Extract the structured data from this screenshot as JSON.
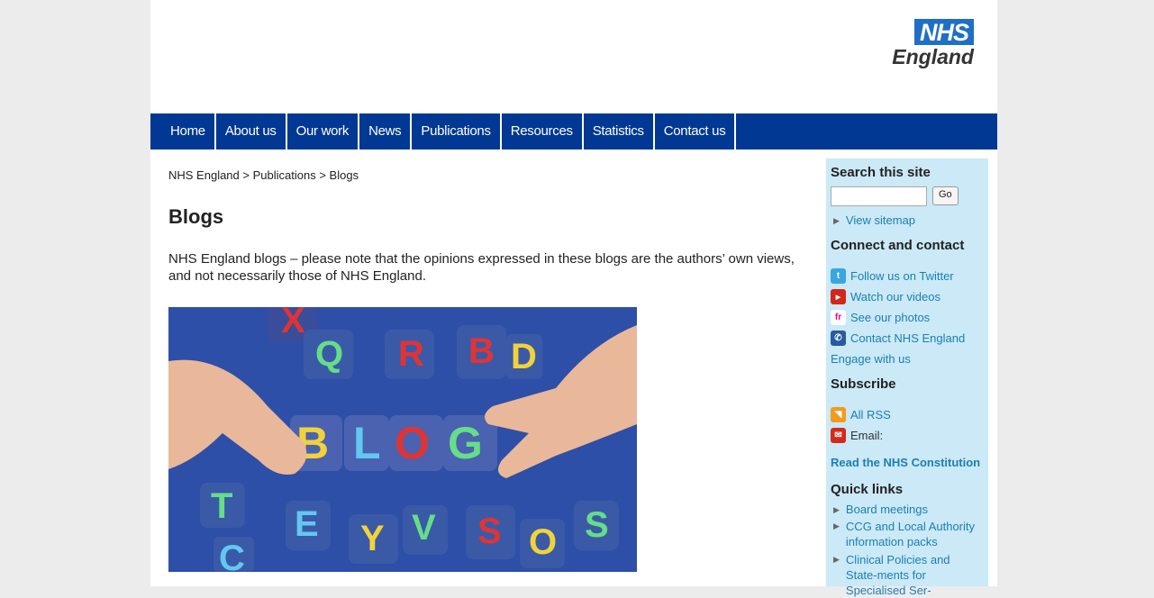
{
  "logo": {
    "nhs": "NHS",
    "england": "England"
  },
  "nav": [
    "Home",
    "About us",
    "Our work",
    "News",
    "Publications",
    "Resources",
    "Statistics",
    "Contact us"
  ],
  "breadcrumb": {
    "home": "NHS England",
    "sep": " > ",
    "section": "Publications",
    "current": "Blogs"
  },
  "page_title": "Blogs",
  "intro": "NHS England blogs – please note that the opinions expressed in these blogs are the authors’ own views, and not necessarily those of NHS England.",
  "sidebar": {
    "search_heading": "Search this site",
    "go_label": "Go",
    "sitemap": "View sitemap",
    "connect_heading": "Connect and contact",
    "twitter": "Follow us on Twitter",
    "videos": "Watch our videos",
    "photos": "See our photos",
    "contact": "Contact NHS England",
    "engage": "Engage with us",
    "subscribe_heading": "Subscribe",
    "rss": "All RSS",
    "email": "Email:",
    "constitution": "Read the NHS Constitution",
    "quicklinks_heading": "Quick links",
    "quicklinks": [
      "Board meetings",
      "CCG and Local Authority information packs",
      "Clinical Policies and State-ments for Specialised Ser-"
    ]
  },
  "hero_letters": "BLOG",
  "colors": {
    "nav": "#003893",
    "sidebar": "#cbe9f6",
    "link": "#1b7fb5",
    "nhs_blue": "#1f6fc5"
  }
}
